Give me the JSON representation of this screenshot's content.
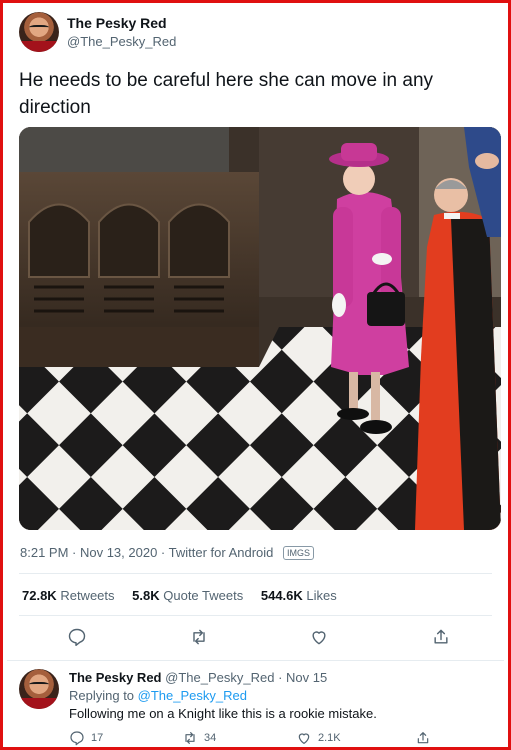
{
  "tweet": {
    "author_name": "The Pesky Red",
    "author_handle": "@The_Pesky_Red",
    "text": "He needs to be careful here she can move in any direction",
    "timestamp": "8:21 PM · Nov 13, 2020 · Twitter for Android",
    "badge": "IMGS",
    "image_alt_icon": "photo-image",
    "stats": {
      "retweets_value": "72.8K",
      "retweets_label": "Retweets",
      "quotes_value": "5.8K",
      "quotes_label": "Quote Tweets",
      "likes_value": "544.6K",
      "likes_label": "Likes"
    },
    "actions": [
      "reply-icon",
      "retweet-icon",
      "like-icon",
      "share-icon"
    ]
  },
  "reply": {
    "author_name": "The Pesky Red",
    "author_handle": "@The_Pesky_Red",
    "date": "· Nov 15",
    "replying_prefix": "Replying to",
    "replying_handle": "@The_Pesky_Red",
    "text": "Following me on a Knight like this is a rookie mistake.",
    "reply_count": "17",
    "retweet_count": "34",
    "like_count": "2.1K"
  },
  "colors": {
    "border": "#e01010",
    "link": "#1d9bf0",
    "muted": "#536471",
    "text": "#0f1419"
  }
}
